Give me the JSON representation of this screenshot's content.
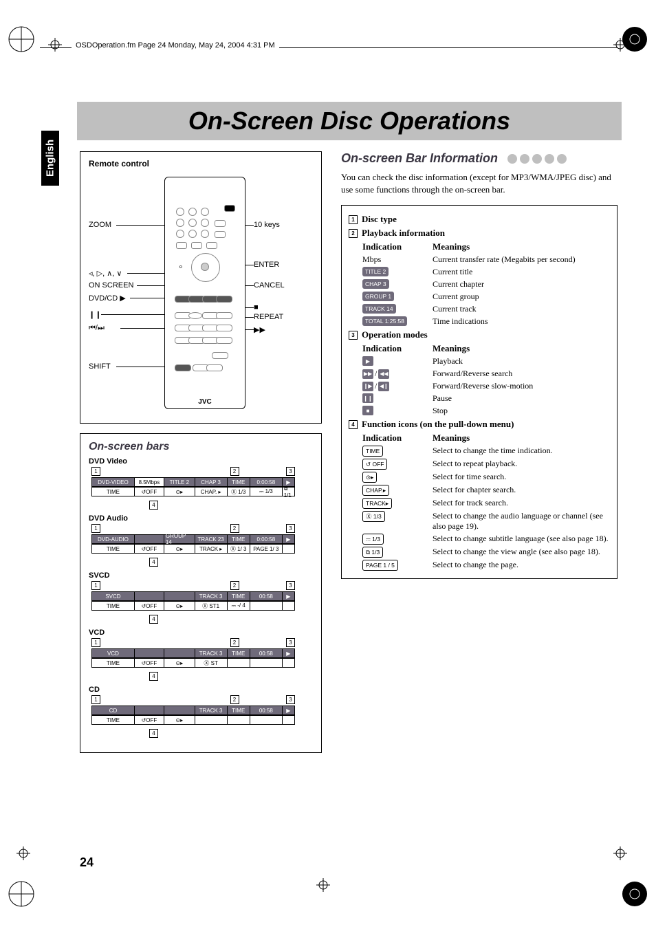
{
  "header_meta": "OSDOperation.fm  Page 24  Monday, May 24, 2004  4:31 PM",
  "side_tab": "English",
  "title": "On-Screen Disc Operations",
  "page_number": "24",
  "remote_panel_title": "Remote control",
  "remote_brand": "JVC",
  "remote_labels_left": [
    "ZOOM",
    "◃, ▷, ∧, ∨",
    "ON SCREEN",
    "DVD/CD ▶",
    "❙❙",
    "⏮/⏭",
    "SHIFT"
  ],
  "remote_labels_right": [
    "10 keys",
    "ENTER",
    "CANCEL",
    "■",
    "REPEAT",
    "▶▶"
  ],
  "osb_title": "On-screen bars",
  "osb_groups": [
    {
      "sub": "DVD Video",
      "top_row": [
        "DVD-VIDEO",
        "8.5Mbps",
        "TITLE 2",
        "CHAP 3",
        "TIME",
        "0:00:58",
        "▶"
      ],
      "top_styles": [
        "dark",
        "light",
        "dark",
        "dark",
        "dark",
        "dark",
        "dark"
      ],
      "bot_row": [
        "TIME",
        "↺OFF",
        "⊙▸",
        "CHAP. ▸",
        "Ⓧ 1/3",
        "⎓ 1/3",
        "⧉ 1/1"
      ],
      "bot_styles": [
        "light",
        "light",
        "light",
        "light",
        "light",
        "light",
        "light"
      ],
      "markers_top": [
        "1",
        "2",
        "3"
      ],
      "marker_bot": "4"
    },
    {
      "sub": "DVD Audio",
      "top_row": [
        "DVD-AUDIO",
        "",
        "GROUP 14",
        "TRACK 23",
        "TIME",
        "0:00:58",
        "▶"
      ],
      "top_styles": [
        "dark",
        "dark",
        "dark",
        "dark",
        "dark",
        "dark",
        "dark"
      ],
      "bot_row": [
        "TIME",
        "↺OFF",
        "⊙▸",
        "TRACK ▸",
        "Ⓧ 1/ 3",
        "PAGE 1/ 3",
        ""
      ],
      "bot_styles": [
        "light",
        "light",
        "light",
        "light",
        "light",
        "light",
        "light"
      ],
      "markers_top": [
        "1",
        "2",
        "3"
      ],
      "marker_bot": "4"
    },
    {
      "sub": "SVCD",
      "top_row": [
        "SVCD",
        "",
        "",
        "TRACK 3",
        "TIME",
        "00:58",
        "▶"
      ],
      "top_styles": [
        "dark",
        "dark",
        "dark",
        "dark",
        "dark",
        "dark",
        "dark"
      ],
      "bot_row": [
        "TIME",
        "↺OFF",
        "⊙▸",
        "Ⓧ ST1",
        "⎓ -/ 4",
        "",
        ""
      ],
      "bot_styles": [
        "light",
        "light",
        "light",
        "light",
        "light",
        "light",
        "light"
      ],
      "markers_top": [
        "1",
        "2",
        "3"
      ],
      "marker_bot": "4"
    },
    {
      "sub": "VCD",
      "top_row": [
        "VCD",
        "",
        "",
        "TRACK 3",
        "TIME",
        "00:58",
        "▶"
      ],
      "top_styles": [
        "dark",
        "dark",
        "dark",
        "dark",
        "dark",
        "dark",
        "dark"
      ],
      "bot_row": [
        "TIME",
        "↺OFF",
        "⊙▸",
        "Ⓧ ST",
        "",
        "",
        ""
      ],
      "bot_styles": [
        "light",
        "light",
        "light",
        "light",
        "light",
        "light",
        "light"
      ],
      "markers_top": [
        "1",
        "2",
        "3"
      ],
      "marker_bot": "4"
    },
    {
      "sub": "CD",
      "top_row": [
        "CD",
        "",
        "",
        "TRACK 3",
        "TIME",
        "00:58",
        "▶"
      ],
      "top_styles": [
        "dark",
        "dark",
        "dark",
        "dark",
        "dark",
        "dark",
        "dark"
      ],
      "bot_row": [
        "TIME",
        "↺OFF",
        "⊙▸",
        "",
        "",
        "",
        ""
      ],
      "bot_styles": [
        "light",
        "light",
        "light",
        "light",
        "light",
        "light",
        "light"
      ],
      "markers_top": [
        "1",
        "2",
        "3"
      ],
      "marker_bot": "4"
    }
  ],
  "right_section_title": "On-screen Bar Information",
  "right_intro": "You can check the disc information (except for MP3/WMA/JPEG disc) and use some functions through the on-screen bar.",
  "table": {
    "sections": [
      {
        "num": "1",
        "head": "Disc type",
        "rows": []
      },
      {
        "num": "2",
        "head": "Playback information",
        "cols": [
          "Indication",
          "Meanings"
        ],
        "rows": [
          {
            "kind": "text",
            "ind": "Mbps",
            "mean": "Current transfer rate (Megabits per second)"
          },
          {
            "kind": "pill-dark",
            "ind": "TITLE 2",
            "mean": "Current title"
          },
          {
            "kind": "pill-dark",
            "ind": "CHAP 3",
            "mean": "Current chapter"
          },
          {
            "kind": "pill-dark",
            "ind": "GROUP 1",
            "mean": "Current group"
          },
          {
            "kind": "pill-dark",
            "ind": "TRACK 14",
            "mean": "Current track"
          },
          {
            "kind": "pill-dark",
            "ind": "TOTAL 1:25:58",
            "mean": "Time indications"
          }
        ]
      },
      {
        "num": "3",
        "head": "Operation modes",
        "cols": [
          "Indication",
          "Meanings"
        ],
        "rows": [
          {
            "kind": "op",
            "glyph": "▶",
            "mean": "Playback"
          },
          {
            "kind": "op2",
            "g1": "▶▶",
            "g2": "◀◀",
            "mean": "Forward/Reverse search"
          },
          {
            "kind": "op2",
            "g1": "❙▶",
            "g2": "◀❙",
            "mean": "Forward/Reverse slow-motion"
          },
          {
            "kind": "op",
            "glyph": "❙❙",
            "mean": "Pause"
          },
          {
            "kind": "op",
            "glyph": "■",
            "mean": "Stop"
          }
        ]
      },
      {
        "num": "4",
        "head": "Function icons (on the pull-down menu)",
        "cols": [
          "Indication",
          "Meanings"
        ],
        "rows": [
          {
            "kind": "pill-out",
            "ind": "TIME",
            "mean": "Select to change the time indication."
          },
          {
            "kind": "pill-out",
            "ind": "↺ OFF",
            "mean": "Select to repeat playback."
          },
          {
            "kind": "pill-out",
            "ind": "⊙▸",
            "mean": "Select for time search."
          },
          {
            "kind": "pill-out",
            "ind": "CHAP.▸",
            "mean": "Select for chapter search."
          },
          {
            "kind": "pill-out",
            "ind": "TRACK▸",
            "mean": "Select for track search."
          },
          {
            "kind": "pill-out",
            "ind": "Ⓧ 1/3",
            "mean": "Select to change the audio language or channel (see also page 19)."
          },
          {
            "kind": "pill-out",
            "ind": "⎓ 1/3",
            "mean": "Select to change subtitle language (see also page 18)."
          },
          {
            "kind": "pill-out",
            "ind": "⧉ 1/3",
            "mean": "Select to change the view angle (see also page 18)."
          },
          {
            "kind": "pill-out",
            "ind": "PAGE 1 / 5",
            "mean": "Select to change the page."
          }
        ]
      }
    ]
  }
}
